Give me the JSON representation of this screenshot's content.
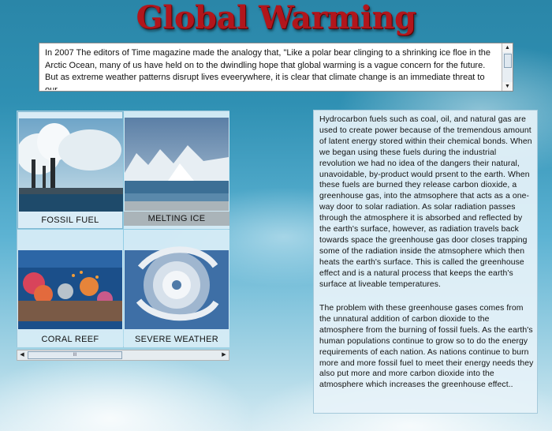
{
  "header": {
    "title": "Global Warming"
  },
  "intro": {
    "text": "In 2007 The editors of Time magazine made the analogy that, \"Like a polar bear clinging to a shrinking ice floe in the Arctic Ocean, many of us have held on to the dwindling hope that global warming is a vague concern for the future. But as extreme weather patterns disrupt lives eveerywhere, it is clear that climate change is an immediate threat to our"
  },
  "gallery": {
    "items": [
      {
        "label": "FOSSIL FUEL"
      },
      {
        "label": "MELTING ICE"
      },
      {
        "label": "CORAL REEF"
      },
      {
        "label": "SEVERE WEATHER"
      }
    ],
    "scroll_thumb": "III"
  },
  "info": {
    "para1": "Hydrocarbon fuels such as coal, oil, and natural gas are used to create power because of the tremendous amount of latent energy stored within their chemical bonds. When we began using these fuels during the industrial revolution we had no idea of the dangers their natural, unavoidable, by-product would prsent to the earth. When these fuels are burned they release carbon dioxide, a greenhouse gas, into the atmsophere that acts as a one-way door to solar radiation. As solar radiation passes through the atmosphere it is absorbed and reflected by the earth's surface, however, as radiation travels back towards space the greenhouse gas door closes trapping some of the radiation inside the atmsophere which then heats the earth's surface. This is called the greenhouse effect and is a natural process that keeps the earth's surface at liveable temperatures.",
    "para2": "The problem with these greenhouse gases comes from the unnatural addition of carbon dioxide to the atmosphere from the burning of fossil fuels. As the earth's human populations continue to grow so to do the energy requirements of each nation. As nations continue to burn more and more fossil fuel to meet their energy needs they also put more and more carbon dioxide into the atmosphere which increases the greenhouse effect.."
  },
  "icons": {
    "up": "scroll-up-arrow-icon",
    "down": "scroll-down-arrow-icon",
    "left": "scroll-left-arrow-icon",
    "right": "scroll-right-arrow-icon"
  },
  "colors": {
    "title": "#b2161c",
    "sky": "#2f90b3"
  }
}
